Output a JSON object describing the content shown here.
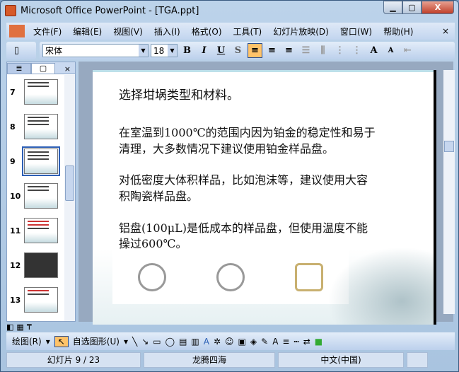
{
  "window": {
    "title": "Microsoft Office PowerPoint - [TGA.ppt]",
    "minimize": "▁",
    "maximize": "▢",
    "close": "X"
  },
  "menu": {
    "items": [
      "文件(F)",
      "编辑(E)",
      "视图(V)",
      "插入(I)",
      "格式(O)",
      "工具(T)",
      "幻灯片放映(D)",
      "窗口(W)",
      "帮助(H)"
    ],
    "close": "×"
  },
  "format": {
    "font": "宋体",
    "size": "18",
    "bold": "B",
    "italic": "I",
    "underline": "U",
    "shadow": "S",
    "grow": "A",
    "shrink": "A"
  },
  "panel": {
    "tab_outline": "≣",
    "tab_slides": "▢",
    "close": "×",
    "slides": [
      "7",
      "8",
      "9",
      "10",
      "11",
      "12",
      "13"
    ],
    "selected": "9"
  },
  "slide": {
    "title": "选择坩埚类型和材料。",
    "p1a": "在室温到1000℃的范围内因为铂金的稳定性和易于",
    "p1b": "清理，大多数情况下建议使用铂金样品盘。",
    "p2a": "对低密度大体积样品，比如泡沫等，建议使用大容",
    "p2b": "积陶瓷样品盘。",
    "p3a": "铝盘(100μL)是低成本的样品盘，但使用温度不能",
    "p3b": "操过600℃。"
  },
  "drawing": {
    "draw": "绘图(R)",
    "autoshapes": "自选图形(U)"
  },
  "status": {
    "slide": "幻灯片 9 / 23",
    "design": "龙腾四海",
    "language": "中文(中国)"
  }
}
